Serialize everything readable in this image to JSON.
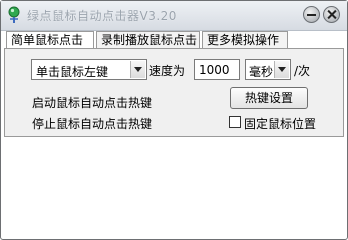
{
  "window": {
    "title": "绿点鼠标自动点击器V3.20"
  },
  "icons": {
    "app": "green-pin-icon",
    "minimize": "minimize-icon",
    "close": "close-icon"
  },
  "tabs": [
    {
      "label": "简单鼠标点击",
      "active": true
    },
    {
      "label": "录制播放鼠标点击",
      "active": false
    },
    {
      "label": "更多模拟操作",
      "active": false
    }
  ],
  "simple": {
    "mode_select": "单击鼠标左键",
    "speed_label": "速度为",
    "speed_value": "1000",
    "unit_select": "毫秒",
    "per_label": "/次",
    "start_hotkey_label": "启动鼠标自动点击热键",
    "stop_hotkey_label": "停止鼠标自动点击热键",
    "hotkey_button": "热键设置",
    "fix_position_label": "固定鼠标位置",
    "fix_position_checked": false
  },
  "colors": {
    "panel": "#f0f0f0",
    "titlebar": "#dfe3e8"
  }
}
